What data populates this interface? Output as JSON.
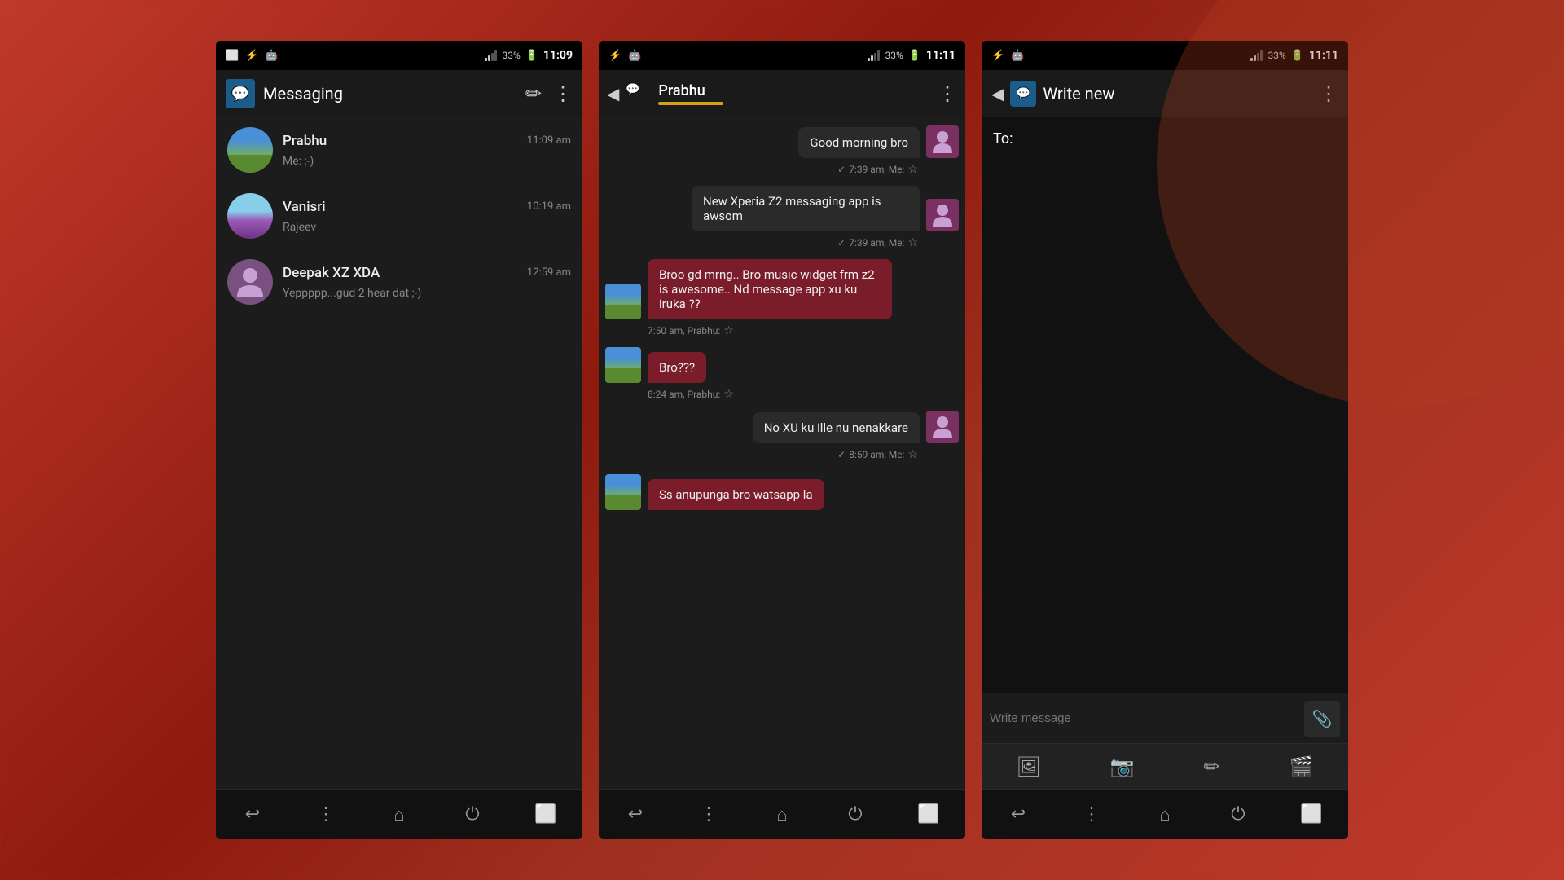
{
  "statusbar": {
    "signal": "33%",
    "battery": "⚡",
    "times": [
      "11:09",
      "11:11",
      "11:11"
    ]
  },
  "phone1": {
    "app_title": "Messaging",
    "toolbar_add_label": "+",
    "toolbar_menu_label": "⋮",
    "contacts": [
      {
        "name": "Prabhu",
        "preview": "Me: ;-)",
        "time": "11:09 am",
        "avatar_type": "landscape"
      },
      {
        "name": "Vanisri",
        "preview": "Rajeev",
        "time": "10:19 am",
        "avatar_type": "flower"
      },
      {
        "name": "Deepak XZ XDA",
        "preview": "Yeppppp...gud 2 hear dat ;-)",
        "time": "12:59 am",
        "avatar_type": "person"
      }
    ],
    "nav": [
      "↩",
      "⋮",
      "⌂",
      "⏻",
      "⬜"
    ]
  },
  "phone2": {
    "contact_name": "Prabhu",
    "toolbar_menu": "⋮",
    "messages": [
      {
        "id": 1,
        "type": "out",
        "text": "Good morning bro",
        "meta": "✓ 7:39 am, Me:",
        "avatar": "person"
      },
      {
        "id": 2,
        "type": "out",
        "text": "New Xperia Z2 messaging app is awsom",
        "meta": "✓ 7:39 am, Me:",
        "avatar": "person"
      },
      {
        "id": 3,
        "type": "in",
        "text": "Broo gd mrng.. Bro music widget frm z2 is awesome.. Nd message app xu ku iruka ??",
        "meta": "7:50 am, Prabhu:",
        "avatar": "landscape"
      },
      {
        "id": 4,
        "type": "in",
        "text": "Bro???",
        "meta": "8:24 am, Prabhu:",
        "avatar": "landscape"
      },
      {
        "id": 5,
        "type": "out",
        "text": "No XU ku ille nu nenakkare",
        "meta": "✓ 8:59 am, Me:",
        "avatar": "person"
      },
      {
        "id": 6,
        "type": "in",
        "text": "Ss anupunga bro watsapp la",
        "meta": "",
        "avatar": "landscape"
      }
    ],
    "nav": [
      "↩",
      "⋮",
      "⌂",
      "⏻",
      "⬜"
    ]
  },
  "phone3": {
    "app_title": "Write new",
    "toolbar_menu": "⋮",
    "to_label": "To:",
    "to_placeholder": "",
    "message_placeholder": "Write message",
    "attach_icon": "📎",
    "media_icons": [
      "🖼",
      "📷",
      "✏",
      "🎬"
    ],
    "nav": [
      "↩",
      "⋮",
      "⌂",
      "⏻",
      "⬜"
    ]
  }
}
